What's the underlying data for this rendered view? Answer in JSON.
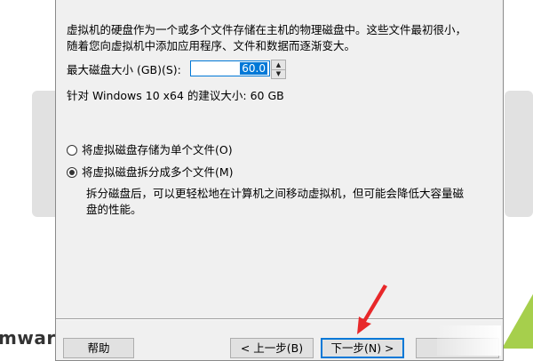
{
  "background": {
    "logo_text": "mwar"
  },
  "wizard": {
    "description_line1": "虚拟机的硬盘作为一个或多个文件存储在主机的物理磁盘中。这些文件最初很小，",
    "description_line2": "随着您向虚拟机中添加应用程序、文件和数据而逐渐变大。",
    "max_size_label": "最大磁盘大小 (GB)(S):",
    "max_size_value": "60.0",
    "recommended_text": "针对 Windows 10 x64 的建议大小: 60 GB",
    "option_single_label": "将虚拟磁盘存储为单个文件(O)",
    "option_split_label": "将虚拟磁盘拆分成多个文件(M)",
    "split_desc_line1": "拆分磁盘后，可以更轻松地在计算机之间移动虚拟机，但可能会降低大容量磁",
    "split_desc_line2": "盘的性能。",
    "selected_option": "split"
  },
  "footer": {
    "help_label": "帮助",
    "back_label": "< 上一步(B)",
    "next_label": "下一步(N) >"
  },
  "colors": {
    "accent": "#0078d7",
    "annotation_arrow": "#e8282a"
  }
}
